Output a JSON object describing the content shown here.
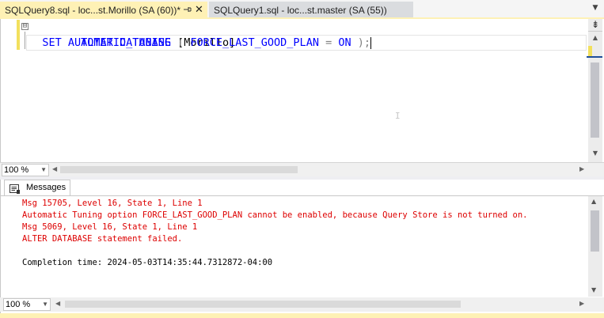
{
  "tabs": [
    {
      "title": "SQLQuery8.sql - loc...st.Morillo (SA (60))*",
      "active": true,
      "pin_icon": "pin-icon",
      "close_label": "✕"
    },
    {
      "title": "SQLQuery1.sql - loc...st.master (SA (55))",
      "active": false
    }
  ],
  "editor": {
    "line1": {
      "fold": "⊟",
      "kw1": "ALTER",
      "kw2": "DATABASE",
      "ident": "[Morillo]"
    },
    "line2": {
      "kw1": "SET",
      "kw2": "AUTOMATIC_TUNING",
      "open": "(",
      "kw3": "FORCE_LAST_GOOD_PLAN",
      "eq": "=",
      "kw4": "ON",
      "close": ")",
      "semi": ";"
    },
    "zoom": "100 %"
  },
  "results": {
    "tab_label": "Messages",
    "lines": [
      {
        "text": "Msg 15705, Level 16, State 1, Line 1",
        "kind": "error"
      },
      {
        "text": "Automatic Tuning option FORCE_LAST_GOOD_PLAN cannot be enabled, because Query Store is not turned on.",
        "kind": "error"
      },
      {
        "text": "Msg 5069, Level 16, State 1, Line 1",
        "kind": "error"
      },
      {
        "text": "ALTER DATABASE statement failed.",
        "kind": "error"
      },
      {
        "text": "",
        "kind": "normal"
      },
      {
        "text": "Completion time: 2024-05-03T14:35:44.7312872-04:00",
        "kind": "normal"
      }
    ],
    "zoom": "100 %"
  },
  "colors": {
    "keyword": "#0000ff",
    "error": "#dd0000",
    "active_tab": "#fef1b5"
  }
}
